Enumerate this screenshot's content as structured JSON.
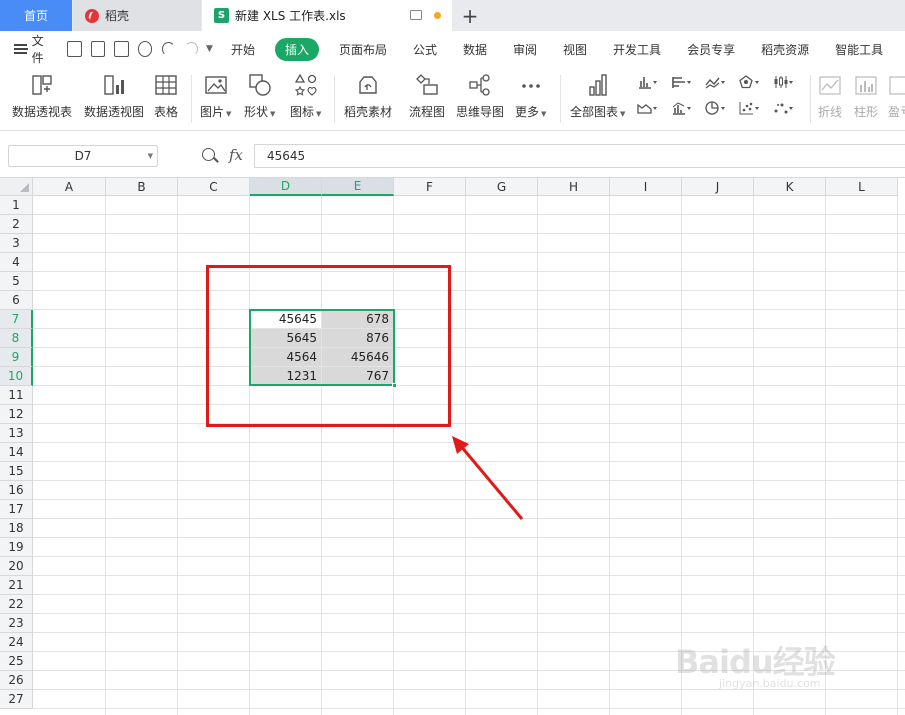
{
  "tabs": {
    "home": "首页",
    "daoke": "稻壳",
    "doc": "新建 XLS 工作表.xls",
    "s_logo": "S"
  },
  "menu": {
    "file": "文件",
    "tabs": [
      "开始",
      "插入",
      "页面布局",
      "公式",
      "数据",
      "审阅",
      "视图",
      "开发工具",
      "会员专享",
      "稻壳资源",
      "智能工具"
    ],
    "active_tab": "插入"
  },
  "ribbon": {
    "pivot_table": "数据透视表",
    "pivot_chart": "数据透视图",
    "table": "表格",
    "picture": "图片",
    "shape": "形状",
    "icon": "图标",
    "daoke_material": "稻壳素材",
    "flowchart": "流程图",
    "mindmap": "思维导图",
    "more": "更多",
    "all_charts": "全部图表",
    "line": "折线",
    "bar": "柱形",
    "profit": "盈亏"
  },
  "formula_bar": {
    "name_box": "D7",
    "fx": "fx",
    "value": "45645"
  },
  "columns": [
    "A",
    "B",
    "C",
    "D",
    "E",
    "F",
    "G",
    "H",
    "I",
    "J",
    "K",
    "L"
  ],
  "rows": [
    "1",
    "2",
    "3",
    "4",
    "5",
    "6",
    "7",
    "8",
    "9",
    "10",
    "11",
    "12",
    "13",
    "14",
    "15",
    "16",
    "17",
    "18",
    "19",
    "20",
    "21",
    "22",
    "23",
    "24",
    "25",
    "26",
    "27"
  ],
  "selected_columns": [
    "D",
    "E"
  ],
  "selected_rows": [
    "7",
    "8",
    "9",
    "10"
  ],
  "cells": [
    {
      "ref": "D7",
      "value": "45645"
    },
    {
      "ref": "E7",
      "value": "678"
    },
    {
      "ref": "D8",
      "value": "5645"
    },
    {
      "ref": "E8",
      "value": "876"
    },
    {
      "ref": "D9",
      "value": "4564"
    },
    {
      "ref": "E9",
      "value": "45646"
    },
    {
      "ref": "D10",
      "value": "1231"
    },
    {
      "ref": "E10",
      "value": "767"
    }
  ],
  "watermark": {
    "text": "Baidu经验",
    "sub": "jingyan.baidu.com"
  },
  "colors": {
    "accent_green": "#1aa866",
    "annotation_red": "#e01919",
    "home_tab_blue": "#4a8cf7"
  }
}
